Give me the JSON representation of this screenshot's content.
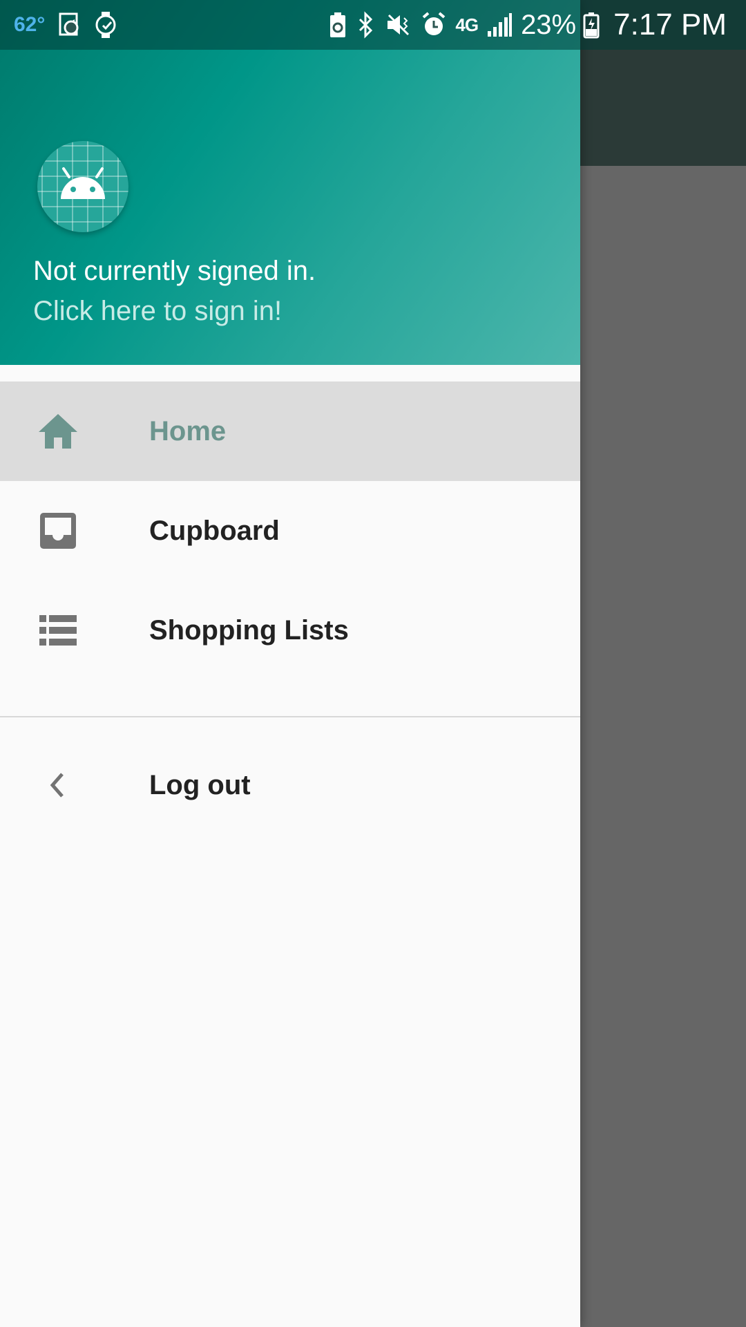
{
  "status_bar": {
    "temperature": "62°",
    "battery_percent": "23%",
    "network": "4G",
    "network_sub": "LTE",
    "time": "7:17 PM",
    "left_icons": [
      "weather-temp",
      "sync-icon",
      "watch-icon"
    ],
    "right_icons": [
      "battery-saver-icon",
      "bluetooth-icon",
      "mute-icon",
      "alarm-icon",
      "lte-icon",
      "signal-icon",
      "battery-charging-icon"
    ]
  },
  "drawer": {
    "header": {
      "title": "Not currently signed in.",
      "link": "Click here to sign in!",
      "avatar_icon": "android-icon"
    },
    "items": [
      {
        "label": "Home",
        "icon": "home-icon",
        "active": true
      },
      {
        "label": "Cupboard",
        "icon": "inbox-icon",
        "active": false
      },
      {
        "label": "Shopping Lists",
        "icon": "list-icon",
        "active": false
      }
    ],
    "footer_items": [
      {
        "label": "Log out",
        "icon": "chevron-left-icon"
      }
    ]
  },
  "colors": {
    "header_start": "#00796b",
    "header_end": "#4db6ac",
    "active_label": "#6c958e",
    "active_bg": "#dcdcdc",
    "scrim": "#666666"
  }
}
